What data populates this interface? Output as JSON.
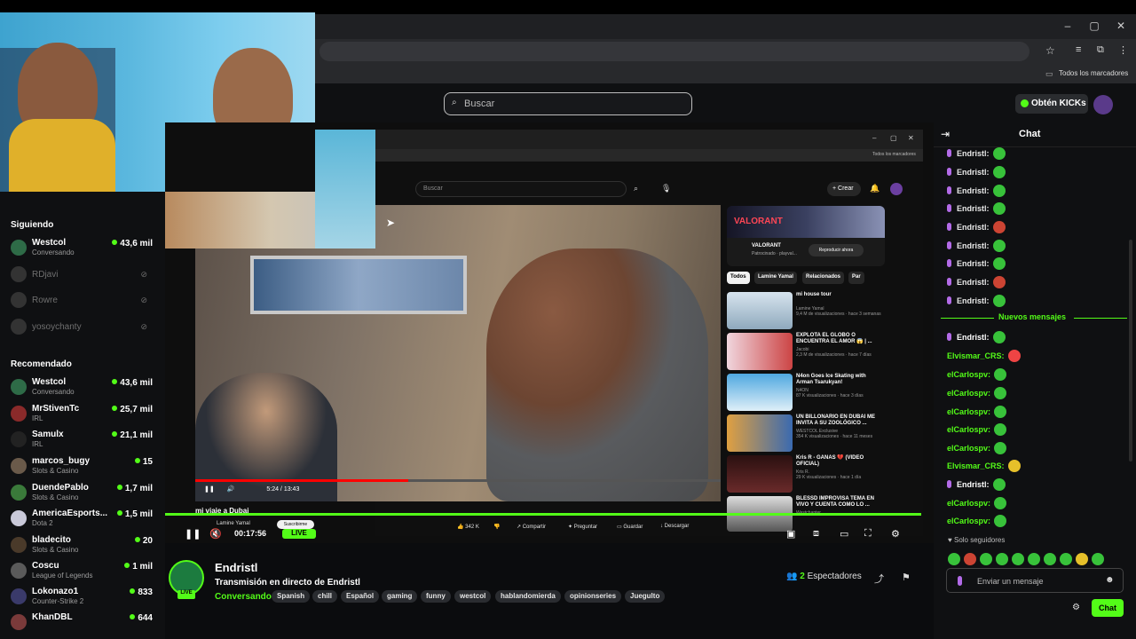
{
  "browser": {
    "bookmarks_label": "Todos los marcadores",
    "window_controls": [
      "–",
      "▢",
      "✕"
    ]
  },
  "header": {
    "search_placeholder": "Buscar",
    "kicks_button": "Obtén KICKs"
  },
  "sidebar": {
    "following_title": "Siguiendo",
    "following": [
      {
        "name": "Westcol",
        "category": "Conversando",
        "viewers": "43,6 mil",
        "online": true
      },
      {
        "name": "RDjavi",
        "online": false
      },
      {
        "name": "Rowre",
        "online": false
      },
      {
        "name": "yosoychanty",
        "online": false
      }
    ],
    "recommended_title": "Recomendado",
    "recommended": [
      {
        "name": "Westcol",
        "category": "Conversando",
        "viewers": "43,6 mil"
      },
      {
        "name": "MrStivenTc",
        "category": "IRL",
        "viewers": "25,7 mil"
      },
      {
        "name": "Samulx",
        "category": "IRL",
        "viewers": "21,1 mil"
      },
      {
        "name": "marcos_bugy",
        "category": "Slots & Casino",
        "viewers": "15"
      },
      {
        "name": "DuendePablo",
        "category": "Slots & Casino",
        "viewers": "1,7 mil"
      },
      {
        "name": "AmericaEsports...",
        "category": "Dota 2",
        "viewers": "1,5 mil"
      },
      {
        "name": "bladecito",
        "category": "Slots & Casino",
        "viewers": "20"
      },
      {
        "name": "Coscu",
        "category": "League of Legends",
        "viewers": "1 mil"
      },
      {
        "name": "Lokonazo1",
        "category": "Counter-Strike 2",
        "viewers": "833"
      },
      {
        "name": "KhanDBL",
        "category": "",
        "viewers": "644"
      }
    ]
  },
  "inner_youtube": {
    "search_placeholder": "Buscar",
    "create_label": "Crear",
    "bookmarks_label": "Todos los marcadores",
    "ad": {
      "brand": "VALORANT",
      "title": "VALORANT",
      "sponsor": "Patrocinado · playval...",
      "cta": "Reproducir ahora"
    },
    "chips": [
      "Todos",
      "Lamine Yamal",
      "Relacionados",
      "Par"
    ],
    "recommendations": [
      {
        "title": "mi house tour",
        "channel": "Lamine Yamal",
        "meta": "9,4 M de visualizaciones · hace 3 semanas",
        "duration": "10:56"
      },
      {
        "title": "EXPLOTA EL GLOBO O ENCUENTRA EL AMOR 😱 | ...",
        "channel": "Jacobi",
        "meta": "2,3 M de visualizaciones · hace 7 días",
        "duration": "24:59"
      },
      {
        "title": "N4on Goes Ice Skating with Arman Tsarukyan!",
        "channel": "N4ON",
        "meta": "87 K visualizaciones · hace 3 días",
        "duration": "26:42"
      },
      {
        "title": "UN BILLONARIO EN DUBAI ME INVITA A SU ZOOLÓGICO ...",
        "channel": "WESTCOL Exclusive",
        "meta": "354 K visualizaciones · hace 11 meses",
        "duration": "24:05"
      },
      {
        "title": "Kris R - GANAS 💔 (VIDEO OFICIAL)",
        "channel": "Kris R.",
        "meta": "29 K visualizaciones · hace 1 día",
        "duration": "3:12"
      },
      {
        "title": "BLESSD IMPROVISA TEMA EN VIVO Y CUENTA COMO LO ...",
        "channel": "Westchapter",
        "meta": "",
        "duration": ""
      }
    ],
    "video_caption": "mi viaje a Dubai",
    "video_time": "5:24 / 13:43",
    "channel_small": "Lamine Yamal",
    "subscribe": "Suscribirme",
    "actions": [
      "342 K",
      "Compartir",
      "Preguntar",
      "Guardar",
      "Descargar"
    ]
  },
  "player": {
    "timer": "00:17:56",
    "live_label": "LIVE"
  },
  "stream": {
    "channel": "Endristl",
    "title": "Transmisión en directo de Endristl",
    "category": "Conversando",
    "tags": [
      "Spanish",
      "chill",
      "Español",
      "gaming",
      "funny",
      "westcol",
      "hablandomierda",
      "opinionseries",
      "Juegulto"
    ],
    "viewers_count": "2",
    "viewers_label": "Espectadores",
    "live_badge": "LIVE"
  },
  "chat": {
    "title": "Chat",
    "new_messages_label": "Nuevos mensajes",
    "messages_before": [
      {
        "user": "Endristl:"
      },
      {
        "user": "Endristl:"
      },
      {
        "user": "Endristl:"
      },
      {
        "user": "Endristl:"
      },
      {
        "user": "Endristl:"
      },
      {
        "user": "Endristl:"
      },
      {
        "user": "Endristl:"
      },
      {
        "user": "Endristl:"
      },
      {
        "user": "Endristl:"
      }
    ],
    "messages_after": [
      {
        "user": "Endristl:",
        "color": "#ffffff"
      },
      {
        "user": "Elvismar_CRS:",
        "color": "#53fc18"
      },
      {
        "user": "elCarlospv:",
        "color": "#53fc18"
      },
      {
        "user": "elCarlospv:",
        "color": "#53fc18"
      },
      {
        "user": "elCarlospv:",
        "color": "#53fc18"
      },
      {
        "user": "elCarlospv:",
        "color": "#53fc18"
      },
      {
        "user": "elCarlospv:",
        "color": "#53fc18"
      },
      {
        "user": "Elvismar_CRS:",
        "color": "#53fc18"
      },
      {
        "user": "Endristl:",
        "color": "#ffffff"
      },
      {
        "user": "elCarlospv:",
        "color": "#53fc18"
      },
      {
        "user": "elCarlospv:",
        "color": "#53fc18"
      }
    ],
    "followers_only": "Solo seguidores",
    "input_placeholder": "Enviar un mensaje",
    "send_label": "Chat"
  },
  "colors": {
    "accent": "#53fc18",
    "background": "#0b0c0e"
  }
}
